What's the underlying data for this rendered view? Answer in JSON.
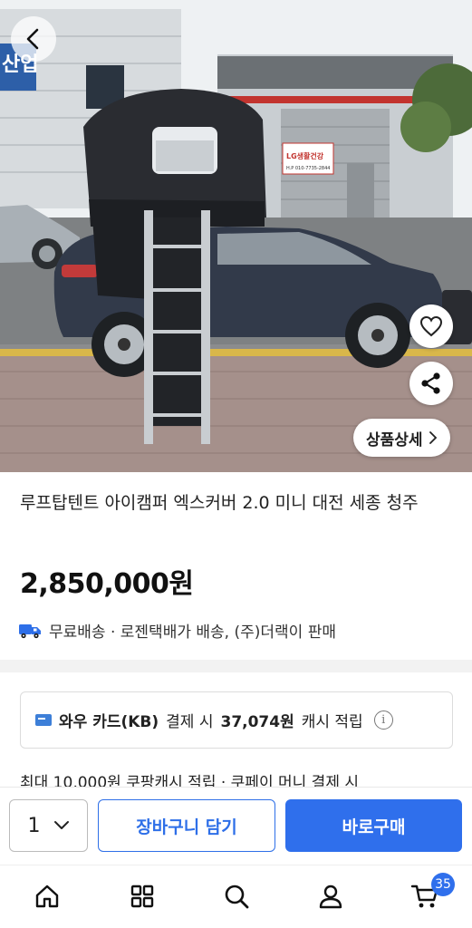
{
  "photo": {
    "alt_scene": "roof top tent on SUV",
    "sign_store": "LG생활건강",
    "sign_phone": "H.P 010-7735-2844",
    "sign_building": "산업"
  },
  "photo_actions": {
    "detail_label": "상품상세"
  },
  "product": {
    "title": "루프탑텐트 아이캠퍼 엑스커버 2.0 미니 대전 세종 청주",
    "price": "2,850,000원",
    "shipping": "무료배송 · 로젠택배가 배송, (주)더랙이 판매"
  },
  "card_benefit": {
    "card_name": "와우 카드(KB)",
    "text_middle": "결제 시",
    "amount": "37,074원",
    "text_end": "캐시 적립"
  },
  "cash_line": "최대 10,000원 쿠팡캐시 적립 · 쿠페이 머니 결제 시",
  "purchase": {
    "quantity": "1",
    "cart_label": "장바구니 담기",
    "buy_label": "바로구매"
  },
  "nav": {
    "cart_badge": "35"
  },
  "colors": {
    "accent": "#2f6fec",
    "delivery_truck": "#2e6fe8"
  }
}
